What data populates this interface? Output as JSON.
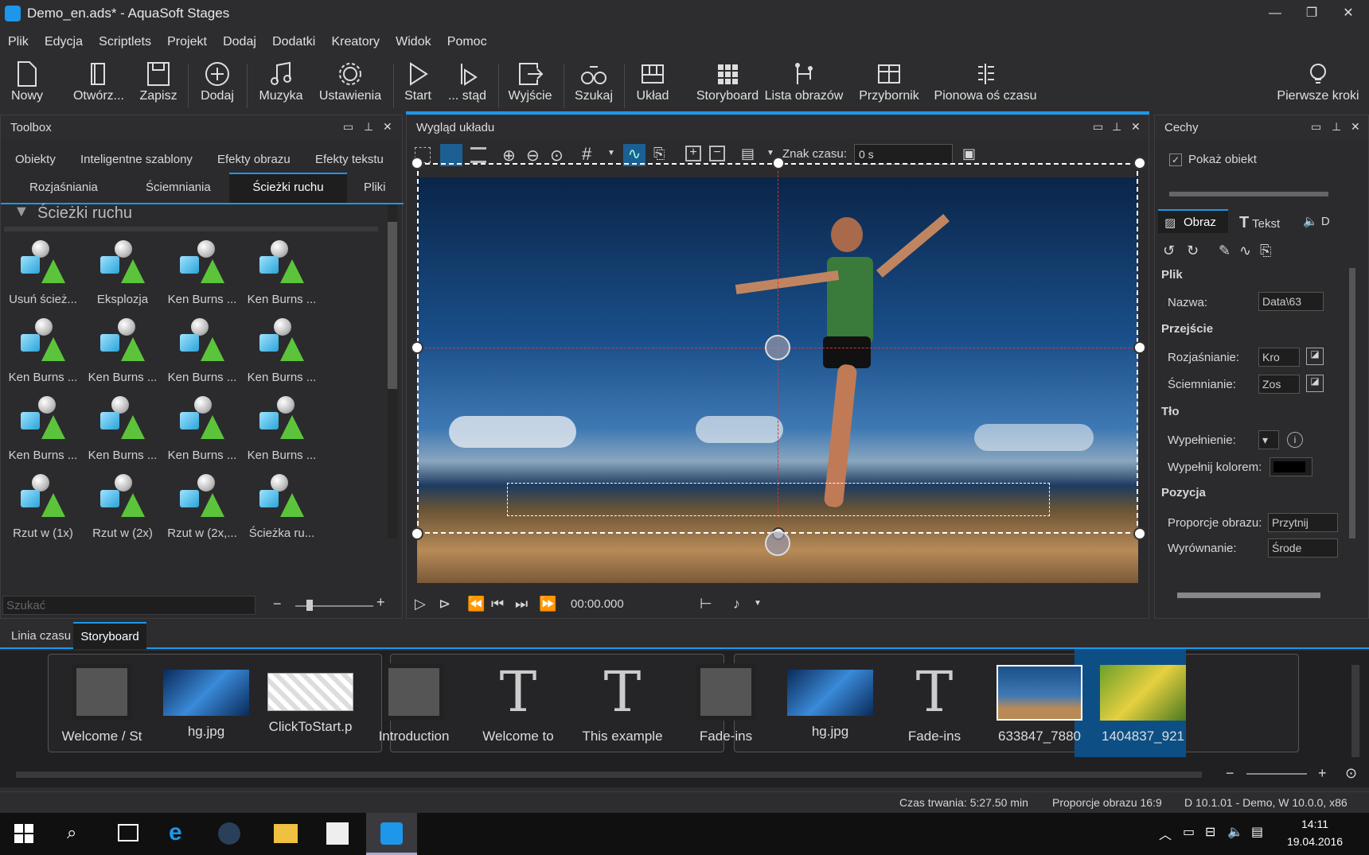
{
  "window": {
    "title": "Demo_en.ads* - AquaSoft Stages",
    "minimize": "—",
    "restore": "❐",
    "close": "✕"
  },
  "menu": [
    "Plik",
    "Edycja",
    "Scriptlets",
    "Projekt",
    "Dodaj",
    "Dodatki",
    "Kreatory",
    "Widok",
    "Pomoc"
  ],
  "ribbon": {
    "new": "Nowy",
    "open": "Otwórz...",
    "save": "Zapisz",
    "add": "Dodaj",
    "music": "Muzyka",
    "settings": "Ustawienia",
    "start": "Start",
    "from_here": "... stąd",
    "output": "Wyjście",
    "search": "Szukaj",
    "layout": "Układ",
    "storyboard": "Storyboard",
    "image_list": "Lista obrazów",
    "toolbox": "Przybornik",
    "vertical_timeline": "Pionowa oś czasu",
    "first_steps": "Pierwsze kroki"
  },
  "toolbox": {
    "title": "Toolbox",
    "tabs_row1": [
      "Obiekty",
      "Inteligentne szablony",
      "Efekty obrazu",
      "Efekty tekstu"
    ],
    "tabs_row2": [
      "Rozjaśniania",
      "Ściemniania",
      "Ścieżki ruchu",
      "Pliki"
    ],
    "section": "Ścieżki ruchu",
    "items": [
      "Usuń ścież...",
      "Eksplozja",
      "Ken Burns ...",
      "Ken Burns ...",
      "Ken Burns ...",
      "Ken Burns ...",
      "Ken Burns ...",
      "Ken Burns ...",
      "Ken Burns ...",
      "Ken Burns ...",
      "Ken Burns ...",
      "Ken Burns ...",
      "Rzut w (1x)",
      "Rzut w (2x)",
      "Rzut w (2x,...",
      "Ścieżka ru..."
    ],
    "search_placeholder": "Szukać"
  },
  "layout_view": {
    "title": "Wygląd układu",
    "time_label": "Znak czasu:",
    "time_value": "0 s",
    "playback_time": "00:00.000"
  },
  "properties": {
    "title": "Cechy",
    "show_object": "Pokaż obiekt",
    "tabs": [
      "Obraz",
      "Tekst",
      "D"
    ],
    "sec_file": "Plik",
    "name_label": "Nazwa:",
    "name_value": "Data\\63",
    "sec_transition": "Przejście",
    "fade_in_label": "Rozjaśnianie:",
    "fade_in_value": "Kro",
    "fade_out_label": "Ściemnianie:",
    "fade_out_value": "Zos",
    "sec_background": "Tło",
    "fill_label": "Wypełnienie:",
    "fill_color_label": "Wypełnij kolorem:",
    "sec_position": "Pozycja",
    "aspect_label": "Proporcje obrazu:",
    "aspect_value": "Przytnij",
    "align_label": "Wyrównanie:",
    "align_value": "Środe"
  },
  "bottom_tabs": [
    "Linia czasu",
    "Storyboard"
  ],
  "storyboard": {
    "items": [
      "Welcome / St",
      "hg.jpg",
      "ClickToStart.p",
      "Introduction",
      "Welcome to",
      "This example",
      "Fade-ins",
      "hg.jpg",
      "Fade-ins",
      "633847_7880",
      "1404837_921"
    ]
  },
  "status": {
    "duration": "Czas trwania: 5:27.50 min",
    "aspect": "Proporcje obrazu 16:9",
    "version": "D 10.1.01 - Demo, W 10.0.0, x86"
  },
  "taskbar": {
    "time": "14:11",
    "date": "19.04.2016"
  },
  "colors": {
    "accent": "#1c97ea",
    "bg": "#2d2d30",
    "panel": "#2b2b2e"
  }
}
